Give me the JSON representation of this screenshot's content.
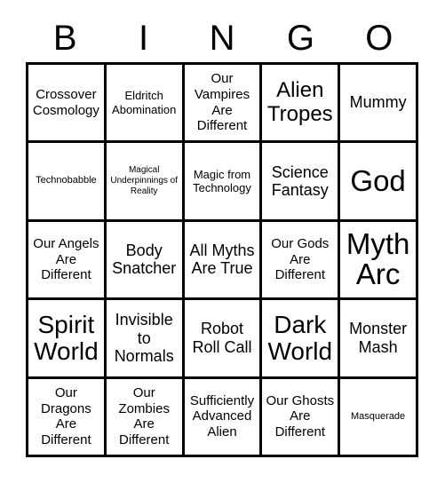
{
  "card": {
    "title": "BINGO",
    "header_letters": [
      "B",
      "I",
      "N",
      "G",
      "O"
    ],
    "background_color": "#ffffff",
    "line_color": "#000000",
    "text_color": "#000000",
    "grid_size": "5x5",
    "cells": [
      {
        "label": "Crossover Cosmology",
        "row": 1,
        "col": 1,
        "column_letter": "B",
        "marked": false
      },
      {
        "label": "Eldritch Abomination",
        "row": 1,
        "col": 2,
        "column_letter": "I",
        "marked": false
      },
      {
        "label": "Our Vampires Are Different",
        "row": 1,
        "col": 3,
        "column_letter": "N",
        "marked": false
      },
      {
        "label": "Alien Tropes",
        "row": 1,
        "col": 4,
        "column_letter": "G",
        "marked": false
      },
      {
        "label": "Mummy",
        "row": 1,
        "col": 5,
        "column_letter": "O",
        "marked": false
      },
      {
        "label": "Technobabble",
        "row": 2,
        "col": 1,
        "column_letter": "B",
        "marked": false
      },
      {
        "label": "Magical Underpinnings of Reality",
        "row": 2,
        "col": 2,
        "column_letter": "I",
        "marked": false
      },
      {
        "label": "Magic from Technology",
        "row": 2,
        "col": 3,
        "column_letter": "N",
        "marked": false
      },
      {
        "label": "Science Fantasy",
        "row": 2,
        "col": 4,
        "column_letter": "G",
        "marked": false
      },
      {
        "label": "God",
        "row": 2,
        "col": 5,
        "column_letter": "O",
        "marked": false
      },
      {
        "label": "Our Angels Are Different",
        "row": 3,
        "col": 1,
        "column_letter": "B",
        "marked": false
      },
      {
        "label": "Body Snatcher",
        "row": 3,
        "col": 2,
        "column_letter": "I",
        "marked": false
      },
      {
        "label": "All Myths Are True",
        "row": 3,
        "col": 3,
        "column_letter": "N",
        "marked": false
      },
      {
        "label": "Our Gods Are Different",
        "row": 3,
        "col": 4,
        "column_letter": "G",
        "marked": false
      },
      {
        "label": "Myth Arc",
        "row": 3,
        "col": 5,
        "column_letter": "O",
        "marked": false
      },
      {
        "label": "Spirit World",
        "row": 4,
        "col": 1,
        "column_letter": "B",
        "marked": false
      },
      {
        "label": "Invisible to Normals",
        "row": 4,
        "col": 2,
        "column_letter": "I",
        "marked": false
      },
      {
        "label": "Robot Roll Call",
        "row": 4,
        "col": 3,
        "column_letter": "N",
        "marked": false
      },
      {
        "label": "Dark World",
        "row": 4,
        "col": 4,
        "column_letter": "G",
        "marked": false
      },
      {
        "label": "Monster Mash",
        "row": 4,
        "col": 5,
        "column_letter": "O",
        "marked": false
      },
      {
        "label": "Our Dragons Are Different",
        "row": 5,
        "col": 1,
        "column_letter": "B",
        "marked": false
      },
      {
        "label": "Our Zombies Are Different",
        "row": 5,
        "col": 2,
        "column_letter": "I",
        "marked": false
      },
      {
        "label": "Sufficiently Advanced Alien",
        "row": 5,
        "col": 3,
        "column_letter": "N",
        "marked": false
      },
      {
        "label": "Our Ghosts Are Different",
        "row": 5,
        "col": 4,
        "column_letter": "G",
        "marked": false
      },
      {
        "label": "Masquerade",
        "row": 5,
        "col": 5,
        "column_letter": "O",
        "marked": false
      }
    ]
  }
}
